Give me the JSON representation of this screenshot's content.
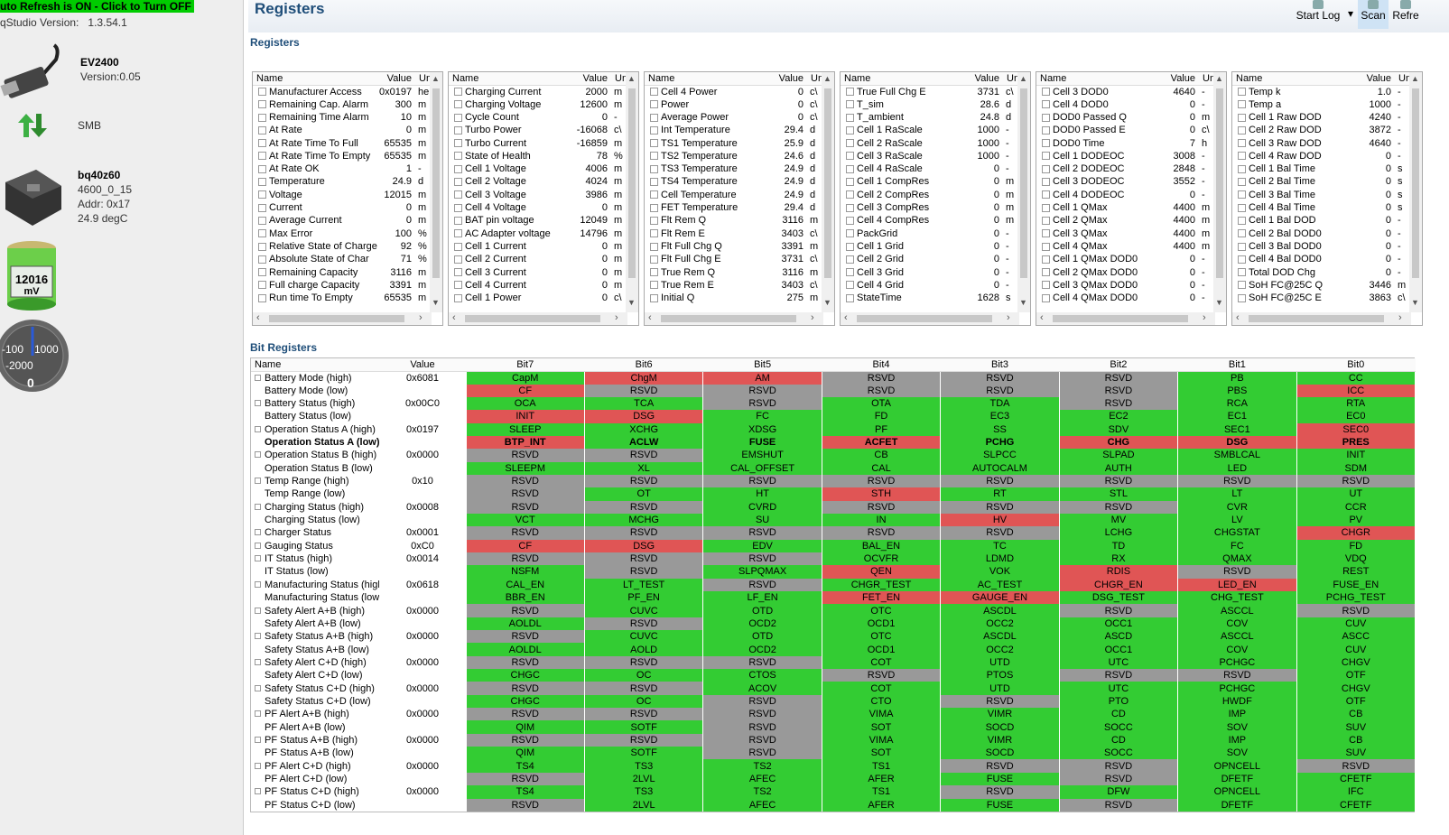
{
  "left": {
    "refresh": "uto Refresh is ON - Click to Turn OFF",
    "version_label": "qStudio Version:",
    "version": "1.3.54.1",
    "ev_name": "EV2400",
    "ev_ver": "Version:0.05",
    "smb": "SMB",
    "gauge_name": "bq40z60",
    "gauge_fw": "4600_0_15",
    "gauge_addr": "Addr: 0x17",
    "gauge_temp": "24.9 degC",
    "battery_mv": "12016",
    "battery_unit": "mV",
    "meter_lbl_l": "-100",
    "meter_lbl_r": "1000",
    "meter_lbl_b": "-2000",
    "meter_val": "0"
  },
  "header": {
    "title": "Registers",
    "start_log": "Start Log",
    "scan": "Scan",
    "refresh": "Refre"
  },
  "registers": {
    "title": "Registers",
    "col_name": "Name",
    "col_value": "Value",
    "col_unit": "Un",
    "panels": [
      [
        [
          "Manufacturer Access",
          "0x0197",
          "he"
        ],
        [
          "Remaining Cap. Alarm",
          "300",
          "m"
        ],
        [
          "Remaining Time Alarm",
          "10",
          "m"
        ],
        [
          "At Rate",
          "0",
          "m"
        ],
        [
          "At Rate Time To Full",
          "65535",
          "m"
        ],
        [
          "At Rate Time To Empty",
          "65535",
          "m"
        ],
        [
          "At Rate OK",
          "1",
          "-"
        ],
        [
          "Temperature",
          "24.9",
          "d"
        ],
        [
          "Voltage",
          "12015",
          "m"
        ],
        [
          "Current",
          "0",
          "m"
        ],
        [
          "Average Current",
          "0",
          "m"
        ],
        [
          "Max Error",
          "100",
          "%"
        ],
        [
          "Relative State of Charge",
          "92",
          "%"
        ],
        [
          "Absolute State of Char",
          "71",
          "%"
        ],
        [
          "Remaining Capacity",
          "3116",
          "m"
        ],
        [
          "Full charge Capacity",
          "3391",
          "m"
        ],
        [
          "Run time To Empty",
          "65535",
          "m"
        ]
      ],
      [
        [
          "Charging Current",
          "2000",
          "m"
        ],
        [
          "Charging Voltage",
          "12600",
          "m"
        ],
        [
          "Cycle Count",
          "0",
          "-"
        ],
        [
          "Turbo Power",
          "-16068",
          "c\\"
        ],
        [
          "Turbo Current",
          "-16859",
          "m"
        ],
        [
          "State of Health",
          "78",
          "%"
        ],
        [
          "Cell 1 Voltage",
          "4006",
          "m"
        ],
        [
          "Cell 2 Voltage",
          "4024",
          "m"
        ],
        [
          "Cell 3 Voltage",
          "3986",
          "m"
        ],
        [
          "Cell 4 Voltage",
          "0",
          "m"
        ],
        [
          "BAT pin voltage",
          "12049",
          "m"
        ],
        [
          "AC Adapter voltage",
          "14796",
          "m"
        ],
        [
          "Cell 1 Current",
          "0",
          "m"
        ],
        [
          "Cell 2 Current",
          "0",
          "m"
        ],
        [
          "Cell 3 Current",
          "0",
          "m"
        ],
        [
          "Cell 4 Current",
          "0",
          "m"
        ],
        [
          "Cell 1 Power",
          "0",
          "c\\"
        ]
      ],
      [
        [
          "Cell 4 Power",
          "0",
          "c\\"
        ],
        [
          "Power",
          "0",
          "c\\"
        ],
        [
          "Average Power",
          "0",
          "c\\"
        ],
        [
          "Int Temperature",
          "29.4",
          "d"
        ],
        [
          "TS1 Temperature",
          "25.9",
          "d"
        ],
        [
          "TS2 Temperature",
          "24.6",
          "d"
        ],
        [
          "TS3 Temperature",
          "24.9",
          "d"
        ],
        [
          "TS4 Temperature",
          "24.9",
          "d"
        ],
        [
          "Cell Temperature",
          "24.9",
          "d"
        ],
        [
          "FET Temperature",
          "29.4",
          "d"
        ],
        [
          "Flt Rem Q",
          "3116",
          "m"
        ],
        [
          "Flt Rem E",
          "3403",
          "c\\"
        ],
        [
          "Flt Full Chg Q",
          "3391",
          "m"
        ],
        [
          "Flt Full Chg E",
          "3731",
          "c\\"
        ],
        [
          "True Rem Q",
          "3116",
          "m"
        ],
        [
          "True Rem E",
          "3403",
          "c\\"
        ],
        [
          "Initial Q",
          "275",
          "m"
        ]
      ],
      [
        [
          "True Full Chg E",
          "3731",
          "c\\"
        ],
        [
          "T_sim",
          "28.6",
          "d"
        ],
        [
          "T_ambient",
          "24.8",
          "d"
        ],
        [
          "Cell 1 RaScale",
          "1000",
          "-"
        ],
        [
          "Cell 2 RaScale",
          "1000",
          "-"
        ],
        [
          "Cell 3 RaScale",
          "1000",
          "-"
        ],
        [
          "Cell 4 RaScale",
          "0",
          "-"
        ],
        [
          "Cell 1 CompRes",
          "0",
          "m"
        ],
        [
          "Cell 2 CompRes",
          "0",
          "m"
        ],
        [
          "Cell 3 CompRes",
          "0",
          "m"
        ],
        [
          "Cell 4 CompRes",
          "0",
          "m"
        ],
        [
          "PackGrid",
          "0",
          "-"
        ],
        [
          "Cell 1 Grid",
          "0",
          "-"
        ],
        [
          "Cell 2 Grid",
          "0",
          "-"
        ],
        [
          "Cell 3 Grid",
          "0",
          "-"
        ],
        [
          "Cell 4 Grid",
          "0",
          "-"
        ],
        [
          "StateTime",
          "1628",
          "s"
        ]
      ],
      [
        [
          "Cell 3 DOD0",
          "4640",
          "-"
        ],
        [
          "Cell 4 DOD0",
          "0",
          "-"
        ],
        [
          "DOD0 Passed Q",
          "0",
          "m"
        ],
        [
          "DOD0 Passed E",
          "0",
          "c\\"
        ],
        [
          "DOD0 Time",
          "7",
          "h"
        ],
        [
          "Cell 1 DODEOC",
          "3008",
          "-"
        ],
        [
          "Cell 2 DODEOC",
          "2848",
          "-"
        ],
        [
          "Cell 3 DODEOC",
          "3552",
          "-"
        ],
        [
          "Cell 4 DODEOC",
          "0",
          "-"
        ],
        [
          "Cell 1 QMax",
          "4400",
          "m"
        ],
        [
          "Cell 2 QMax",
          "4400",
          "m"
        ],
        [
          "Cell 3 QMax",
          "4400",
          "m"
        ],
        [
          "Cell 4 QMax",
          "4400",
          "m"
        ],
        [
          "Cell 1 QMax DOD0",
          "0",
          "-"
        ],
        [
          "Cell 2 QMax DOD0",
          "0",
          "-"
        ],
        [
          "Cell 3 QMax DOD0",
          "0",
          "-"
        ],
        [
          "Cell 4 QMax DOD0",
          "0",
          "-"
        ]
      ],
      [
        [
          "Temp k",
          "1.0",
          "-"
        ],
        [
          "Temp a",
          "1000",
          "-"
        ],
        [
          "Cell 1 Raw DOD",
          "4240",
          "-"
        ],
        [
          "Cell 2 Raw DOD",
          "3872",
          "-"
        ],
        [
          "Cell 3 Raw DOD",
          "4640",
          "-"
        ],
        [
          "Cell 4 Raw DOD",
          "0",
          "-"
        ],
        [
          "Cell 1 Bal Time",
          "0",
          "s"
        ],
        [
          "Cell 2 Bal Time",
          "0",
          "s"
        ],
        [
          "Cell 3 Bal Time",
          "0",
          "s"
        ],
        [
          "Cell 4 Bal Time",
          "0",
          "s"
        ],
        [
          "Cell 1 Bal DOD",
          "0",
          "-"
        ],
        [
          "Cell 2 Bal DOD0",
          "0",
          "-"
        ],
        [
          "Cell 3 Bal DOD0",
          "0",
          "-"
        ],
        [
          "Cell 4 Bal DOD0",
          "0",
          "-"
        ],
        [
          "Total DOD Chg",
          "0",
          "-"
        ],
        [
          "SoH FC@25C Q",
          "3446",
          "m"
        ],
        [
          "SoH FC@25C E",
          "3863",
          "c\\"
        ]
      ]
    ]
  },
  "bits": {
    "title": "Bit Registers",
    "col_name": "Name",
    "col_value": "Value",
    "bit_headers": [
      "Bit7",
      "Bit6",
      "Bit5",
      "Bit4",
      "Bit3",
      "Bit2",
      "Bit1",
      "Bit0"
    ],
    "rows": [
      [
        "Battery Mode (high)",
        "0x6081",
        "CapM:g",
        "ChgM:r",
        "AM:r",
        "RSVD:y",
        "RSVD:y",
        "RSVD:y",
        "PB:g",
        "CC:g"
      ],
      [
        "Battery Mode (low)",
        "",
        "CF:r",
        "RSVD:y",
        "RSVD:y",
        "RSVD:y",
        "RSVD:y",
        "RSVD:y",
        "PBS:g",
        "ICC:r"
      ],
      [
        "Battery Status (high)",
        "0x00C0",
        "OCA:g",
        "TCA:g",
        "RSVD:y",
        "OTA:g",
        "TDA:g",
        "RSVD:y",
        "RCA:g",
        "RTA:g"
      ],
      [
        "Battery Status (low)",
        "",
        "INIT:r",
        "DSG:r",
        "FC:g",
        "FD:g",
        "EC3:g",
        "EC2:g",
        "EC1:g",
        "EC0:g"
      ],
      [
        "Operation Status A (high)",
        "0x0197",
        "SLEEP:g",
        "XCHG:g",
        "XDSG:g",
        "PF:g",
        "SS:g",
        "SDV:g",
        "SEC1:g",
        "SEC0:r"
      ],
      [
        "Operation Status A (low)",
        "",
        "BTP_INT:r",
        "ACLW:g",
        "FUSE:g",
        "ACFET:r",
        "PCHG:g",
        "CHG:r",
        "DSG:r",
        "PRES:r"
      ],
      [
        "Operation Status B (high)",
        "0x0000",
        "RSVD:y",
        "RSVD:y",
        "EMSHUT:g",
        "CB:g",
        "SLPCC:g",
        "SLPAD:g",
        "SMBLCAL:g",
        "INIT:g"
      ],
      [
        "Operation Status B (low)",
        "",
        "SLEEPM:g",
        "XL:g",
        "CAL_OFFSET:g",
        "CAL:g",
        "AUTOCALM:g",
        "AUTH:g",
        "LED:g",
        "SDM:g"
      ],
      [
        "Temp Range (high)",
        "0x10",
        "RSVD:y",
        "RSVD:y",
        "RSVD:y",
        "RSVD:y",
        "RSVD:y",
        "RSVD:y",
        "RSVD:y",
        "RSVD:y"
      ],
      [
        "Temp Range (low)",
        "",
        "RSVD:y",
        "OT:g",
        "HT:g",
        "STH:r",
        "RT:g",
        "STL:g",
        "LT:g",
        "UT:g"
      ],
      [
        "Charging Status (high)",
        "0x0008",
        "RSVD:y",
        "RSVD:y",
        "CVRD:g",
        "RSVD:y",
        "RSVD:y",
        "RSVD:y",
        "CVR:g",
        "CCR:g"
      ],
      [
        "Charging Status (low)",
        "",
        "VCT:g",
        "MCHG:g",
        "SU:g",
        "IN:g",
        "HV:r",
        "MV:g",
        "LV:g",
        "PV:g"
      ],
      [
        "Charger Status",
        "0x0001",
        "RSVD:y",
        "RSVD:y",
        "RSVD:y",
        "RSVD:y",
        "RSVD:y",
        "LCHG:g",
        "CHGSTAT:g",
        "CHGR:r"
      ],
      [
        "Gauging Status",
        "0xC0",
        "CF:r",
        "DSG:r",
        "EDV:g",
        "BAL_EN:g",
        "TC:g",
        "TD:g",
        "FC:g",
        "FD:g"
      ],
      [
        "IT Status (high)",
        "0x0014",
        "RSVD:y",
        "RSVD:y",
        "RSVD:y",
        "OCVFR:g",
        "LDMD:g",
        "RX:g",
        "QMAX:g",
        "VDQ:g"
      ],
      [
        "IT Status (low)",
        "",
        "NSFM:g",
        "RSVD:y",
        "SLPQMAX:g",
        "QEN:r",
        "VOK:g",
        "RDIS:r",
        "RSVD:y",
        "REST:g"
      ],
      [
        "Manufacturing Status (high)",
        "0x0618",
        "CAL_EN:g",
        "LT_TEST:g",
        "RSVD:y",
        "CHGR_TEST:g",
        "AC_TEST:g",
        "CHGR_EN:r",
        "LED_EN:r",
        "FUSE_EN:g"
      ],
      [
        "Manufacturing Status (low)",
        "",
        "BBR_EN:g",
        "PF_EN:g",
        "LF_EN:g",
        "FET_EN:r",
        "GAUGE_EN:r",
        "DSG_TEST:g",
        "CHG_TEST:g",
        "PCHG_TEST:g"
      ],
      [
        "Safety Alert A+B (high)",
        "0x0000",
        "RSVD:y",
        "CUVC:g",
        "OTD:g",
        "OTC:g",
        "ASCDL:g",
        "RSVD:y",
        "ASCCL:g",
        "RSVD:y"
      ],
      [
        "Safety Alert A+B (low)",
        "",
        "AOLDL:g",
        "RSVD:y",
        "OCD2:g",
        "OCD1:g",
        "OCC2:g",
        "OCC1:g",
        "COV:g",
        "CUV:g"
      ],
      [
        "Safety Status A+B (high)",
        "0x0000",
        "RSVD:y",
        "CUVC:g",
        "OTD:g",
        "OTC:g",
        "ASCDL:g",
        "ASCD:g",
        "ASCCL:g",
        "ASCC:g"
      ],
      [
        "Safety Status A+B (low)",
        "",
        "AOLDL:g",
        "AOLD:g",
        "OCD2:g",
        "OCD1:g",
        "OCC2:g",
        "OCC1:g",
        "COV:g",
        "CUV:g"
      ],
      [
        "Safety Alert C+D (high)",
        "0x0000",
        "RSVD:y",
        "RSVD:y",
        "RSVD:y",
        "COT:g",
        "UTD:g",
        "UTC:g",
        "PCHGC:g",
        "CHGV:g"
      ],
      [
        "Safety Alert C+D (low)",
        "",
        "CHGC:g",
        "OC:g",
        "CTOS:g",
        "RSVD:y",
        "PTOS:g",
        "RSVD:y",
        "RSVD:y",
        "OTF:g"
      ],
      [
        "Safety Status C+D (high)",
        "0x0000",
        "RSVD:y",
        "RSVD:y",
        "ACOV:g",
        "COT:g",
        "UTD:g",
        "UTC:g",
        "PCHGC:g",
        "CHGV:g"
      ],
      [
        "Safety Status C+D (low)",
        "",
        "CHGC:g",
        "OC:g",
        "RSVD:y",
        "CTO:g",
        "RSVD:y",
        "PTO:g",
        "HWDF:g",
        "OTF:g"
      ],
      [
        "PF Alert A+B (high)",
        "0x0000",
        "RSVD:y",
        "RSVD:y",
        "RSVD:y",
        "VIMA:g",
        "VIMR:g",
        "CD:g",
        "IMP:g",
        "CB:g"
      ],
      [
        "PF Alert A+B (low)",
        "",
        "QIM:g",
        "SOTF:g",
        "RSVD:y",
        "SOT:g",
        "SOCD:g",
        "SOCC:g",
        "SOV:g",
        "SUV:g"
      ],
      [
        "PF Status A+B (high)",
        "0x0000",
        "RSVD:y",
        "RSVD:y",
        "RSVD:y",
        "VIMA:g",
        "VIMR:g",
        "CD:g",
        "IMP:g",
        "CB:g"
      ],
      [
        "PF Status A+B (low)",
        "",
        "QIM:g",
        "SOTF:g",
        "RSVD:y",
        "SOT:g",
        "SOCD:g",
        "SOCC:g",
        "SOV:g",
        "SUV:g"
      ],
      [
        "PF Alert C+D (high)",
        "0x0000",
        "TS4:g",
        "TS3:g",
        "TS2:g",
        "TS1:g",
        "RSVD:y",
        "RSVD:y",
        "OPNCELL:g",
        "RSVD:y"
      ],
      [
        "PF Alert C+D (low)",
        "",
        "RSVD:y",
        "2LVL:g",
        "AFEC:g",
        "AFER:g",
        "FUSE:g",
        "RSVD:y",
        "DFETF:g",
        "CFETF:g"
      ],
      [
        "PF Status C+D (high)",
        "0x0000",
        "TS4:g",
        "TS3:g",
        "TS2:g",
        "TS1:g",
        "RSVD:y",
        "DFW:g",
        "OPNCELL:g",
        "IFC:g"
      ],
      [
        "PF Status C+D (low)",
        "",
        "RSVD:y",
        "2LVL:g",
        "AFEC:g",
        "AFER:g",
        "FUSE:g",
        "RSVD:y",
        "DFETF:g",
        "CFETF:g"
      ]
    ]
  }
}
